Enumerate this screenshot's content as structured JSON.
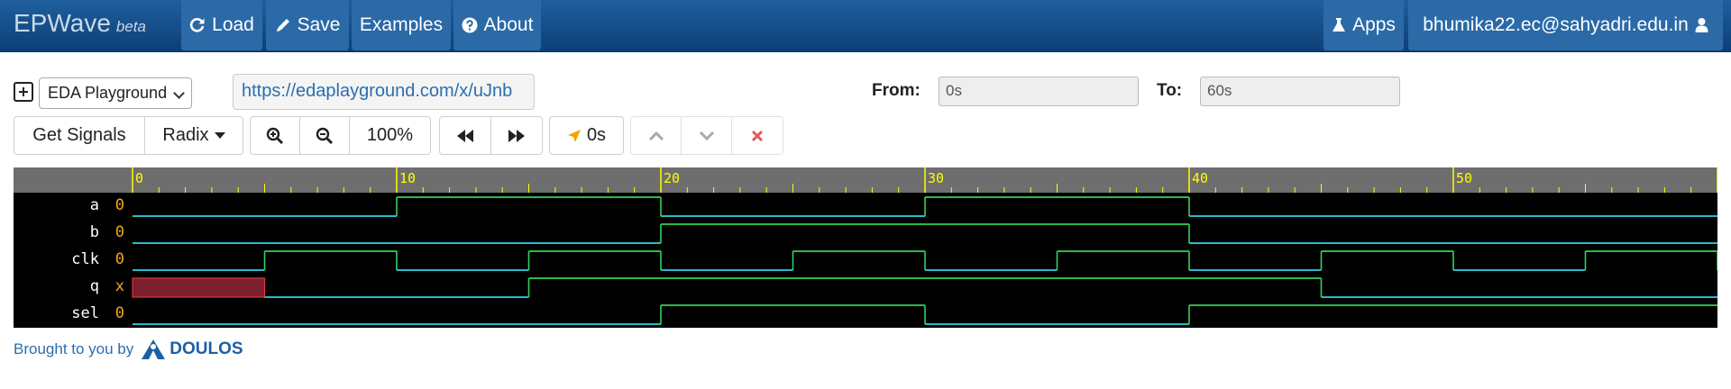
{
  "navbar": {
    "brand": "EPWave",
    "brand_sub": "beta",
    "load_label": "Load",
    "save_label": "Save",
    "examples_label": "Examples",
    "about_label": "About",
    "apps_label": "Apps",
    "user_email": "bhumika22.ec@sahyadri.edu.in"
  },
  "controls": {
    "playground_select": "EDA Playground",
    "url": "https://edaplayground.com/x/uJnb",
    "from_label": "From:",
    "from_value": "0s",
    "to_label": "To:",
    "to_value": "60s"
  },
  "toolbar": {
    "get_signals_label": "Get Signals",
    "radix_label": "Radix",
    "zoom_level": "100%",
    "cursor_time": "0s"
  },
  "waveform": {
    "time_start": 0,
    "time_end": 60,
    "time_ticks": [
      "0",
      "10",
      "20",
      "30",
      "40",
      "50"
    ],
    "signals": [
      {
        "name": "a",
        "value": "0",
        "transitions": [
          [
            0,
            "0"
          ],
          [
            10,
            "1"
          ],
          [
            20,
            "0"
          ],
          [
            30,
            "1"
          ],
          [
            40,
            "0"
          ]
        ]
      },
      {
        "name": "b",
        "value": "0",
        "transitions": [
          [
            0,
            "0"
          ],
          [
            20,
            "1"
          ],
          [
            40,
            "0"
          ]
        ]
      },
      {
        "name": "clk",
        "value": "0",
        "transitions": [
          [
            0,
            "0"
          ],
          [
            5,
            "1"
          ],
          [
            10,
            "0"
          ],
          [
            15,
            "1"
          ],
          [
            20,
            "0"
          ],
          [
            25,
            "1"
          ],
          [
            30,
            "0"
          ],
          [
            35,
            "1"
          ],
          [
            40,
            "0"
          ],
          [
            45,
            "1"
          ],
          [
            50,
            "0"
          ],
          [
            55,
            "1"
          ],
          [
            60,
            "0"
          ]
        ]
      },
      {
        "name": "q",
        "value": "x",
        "transitions": [
          [
            0,
            "x"
          ],
          [
            5,
            "0"
          ],
          [
            15,
            "1"
          ],
          [
            45,
            "0"
          ]
        ]
      },
      {
        "name": "sel",
        "value": "0",
        "transitions": [
          [
            0,
            "0"
          ],
          [
            20,
            "1"
          ],
          [
            30,
            "0"
          ],
          [
            40,
            "1"
          ]
        ]
      }
    ],
    "colors": {
      "background": "#000000",
      "header": "#6e6e6e",
      "tick": "#ffff00",
      "high": "#32d25a",
      "low": "#2fd3e6",
      "unknown_fill": "#7a1f2b",
      "unknown_stroke": "#d83a4a",
      "value_text": "#f5a623"
    }
  },
  "footer": {
    "text": "Brought to you by",
    "logo_text": "DOULOS"
  }
}
